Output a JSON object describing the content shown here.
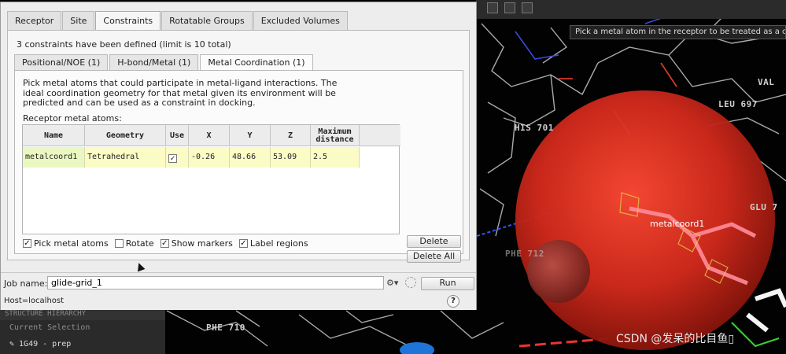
{
  "dialog": {
    "tabs": [
      "Receptor",
      "Site",
      "Constraints",
      "Rotatable Groups",
      "Excluded Volumes"
    ],
    "active_tab": "Constraints",
    "summary": "3 constraints have been defined (limit is 10 total)",
    "subtabs": [
      "Positional/NOE (1)",
      "H-bond/Metal (1)",
      "Metal Coordination (1)"
    ],
    "active_subtab": "Metal Coordination (1)",
    "description": "Pick metal atoms that could participate in metal-ligand interactions.  The ideal coordination geometry for that metal given its environment will be predicted and can be used as a constraint in docking.",
    "receptor_label": "Receptor metal atoms:",
    "table": {
      "headers": [
        "Name",
        "Geometry",
        "Use",
        "X",
        "Y",
        "Z",
        "Maximum distance"
      ],
      "rows": [
        {
          "name": "metalcoord1",
          "geometry": "Tetrahedral",
          "use": true,
          "x": "-0.26",
          "y": "48.66",
          "z": "53.09",
          "max": "2.5"
        }
      ]
    },
    "delete_label": "Delete",
    "delete_all_label": "Delete All",
    "options": [
      {
        "label": "Pick metal atoms",
        "checked": true
      },
      {
        "label": "Rotate",
        "checked": false
      },
      {
        "label": "Show markers",
        "checked": true
      },
      {
        "label": "Label regions",
        "checked": true
      }
    ],
    "job_label": "Job name:",
    "job_value": "glide-grid_1",
    "run_label": "Run",
    "host": "Host=localhost",
    "help": "?"
  },
  "viewer": {
    "tooltip": "Pick a metal atom in the receptor to be treated as a constraint",
    "residue_labels": {
      "his701": "HIS 701",
      "leu697": "LEU 697",
      "val": "VAL",
      "gl": "GLU 7",
      "phe710": "PHE 710",
      "phe": "PHE 712"
    },
    "marker_label": "metalcoord1",
    "watermark": "CSDN @发呆的比目鱼▯"
  },
  "workspace": {
    "header": "STRUCTURE HIERARCHY",
    "current_selection": "Current Selection",
    "entry": "1G49 - prep"
  },
  "colors": {
    "sphere": "#d42a1c",
    "row_highlight": "#fbfbc6",
    "backdrop": "#020202"
  }
}
